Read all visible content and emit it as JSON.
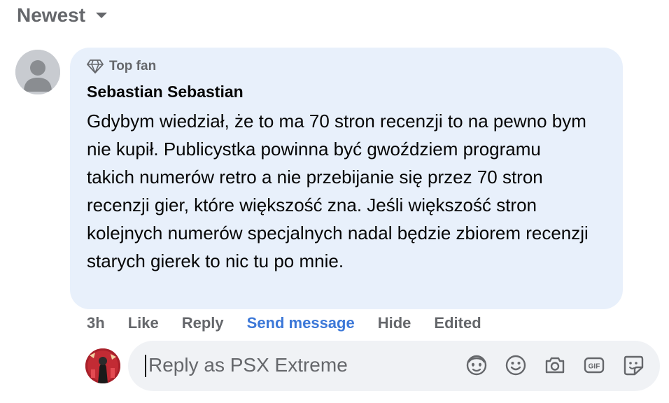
{
  "sort": {
    "label": "Newest",
    "icon": "caret-down-icon"
  },
  "comment": {
    "badge": "Top fan",
    "author": "Sebastian Sebastian",
    "text": "Gdybym wiedział, że to ma 70 stron recenzji to na pewno bym nie kupił. Publicystka powinna być gwoździem programu takich numerów retro a nie przebijanie się przez 70 stron recenzji gier, które większość zna. Jeśli większość stron kolejnych numerów specjalnych nadal będzie zbiorem recenzji starych gierek to nic tu po mnie.",
    "bubble_color": "#e8f0fb"
  },
  "actions": {
    "time": "3h",
    "like": "Like",
    "reply": "Reply",
    "send_message": "Send message",
    "hide": "Hide",
    "edited": "Edited"
  },
  "composer": {
    "placeholder": "Reply as PSX Extreme",
    "icons": [
      "avatar-sticker-icon",
      "emoji-icon",
      "camera-icon",
      "gif-icon",
      "sticker-icon"
    ]
  },
  "colors": {
    "link": "#3c78d8",
    "muted": "#65676b",
    "text": "#050505"
  }
}
